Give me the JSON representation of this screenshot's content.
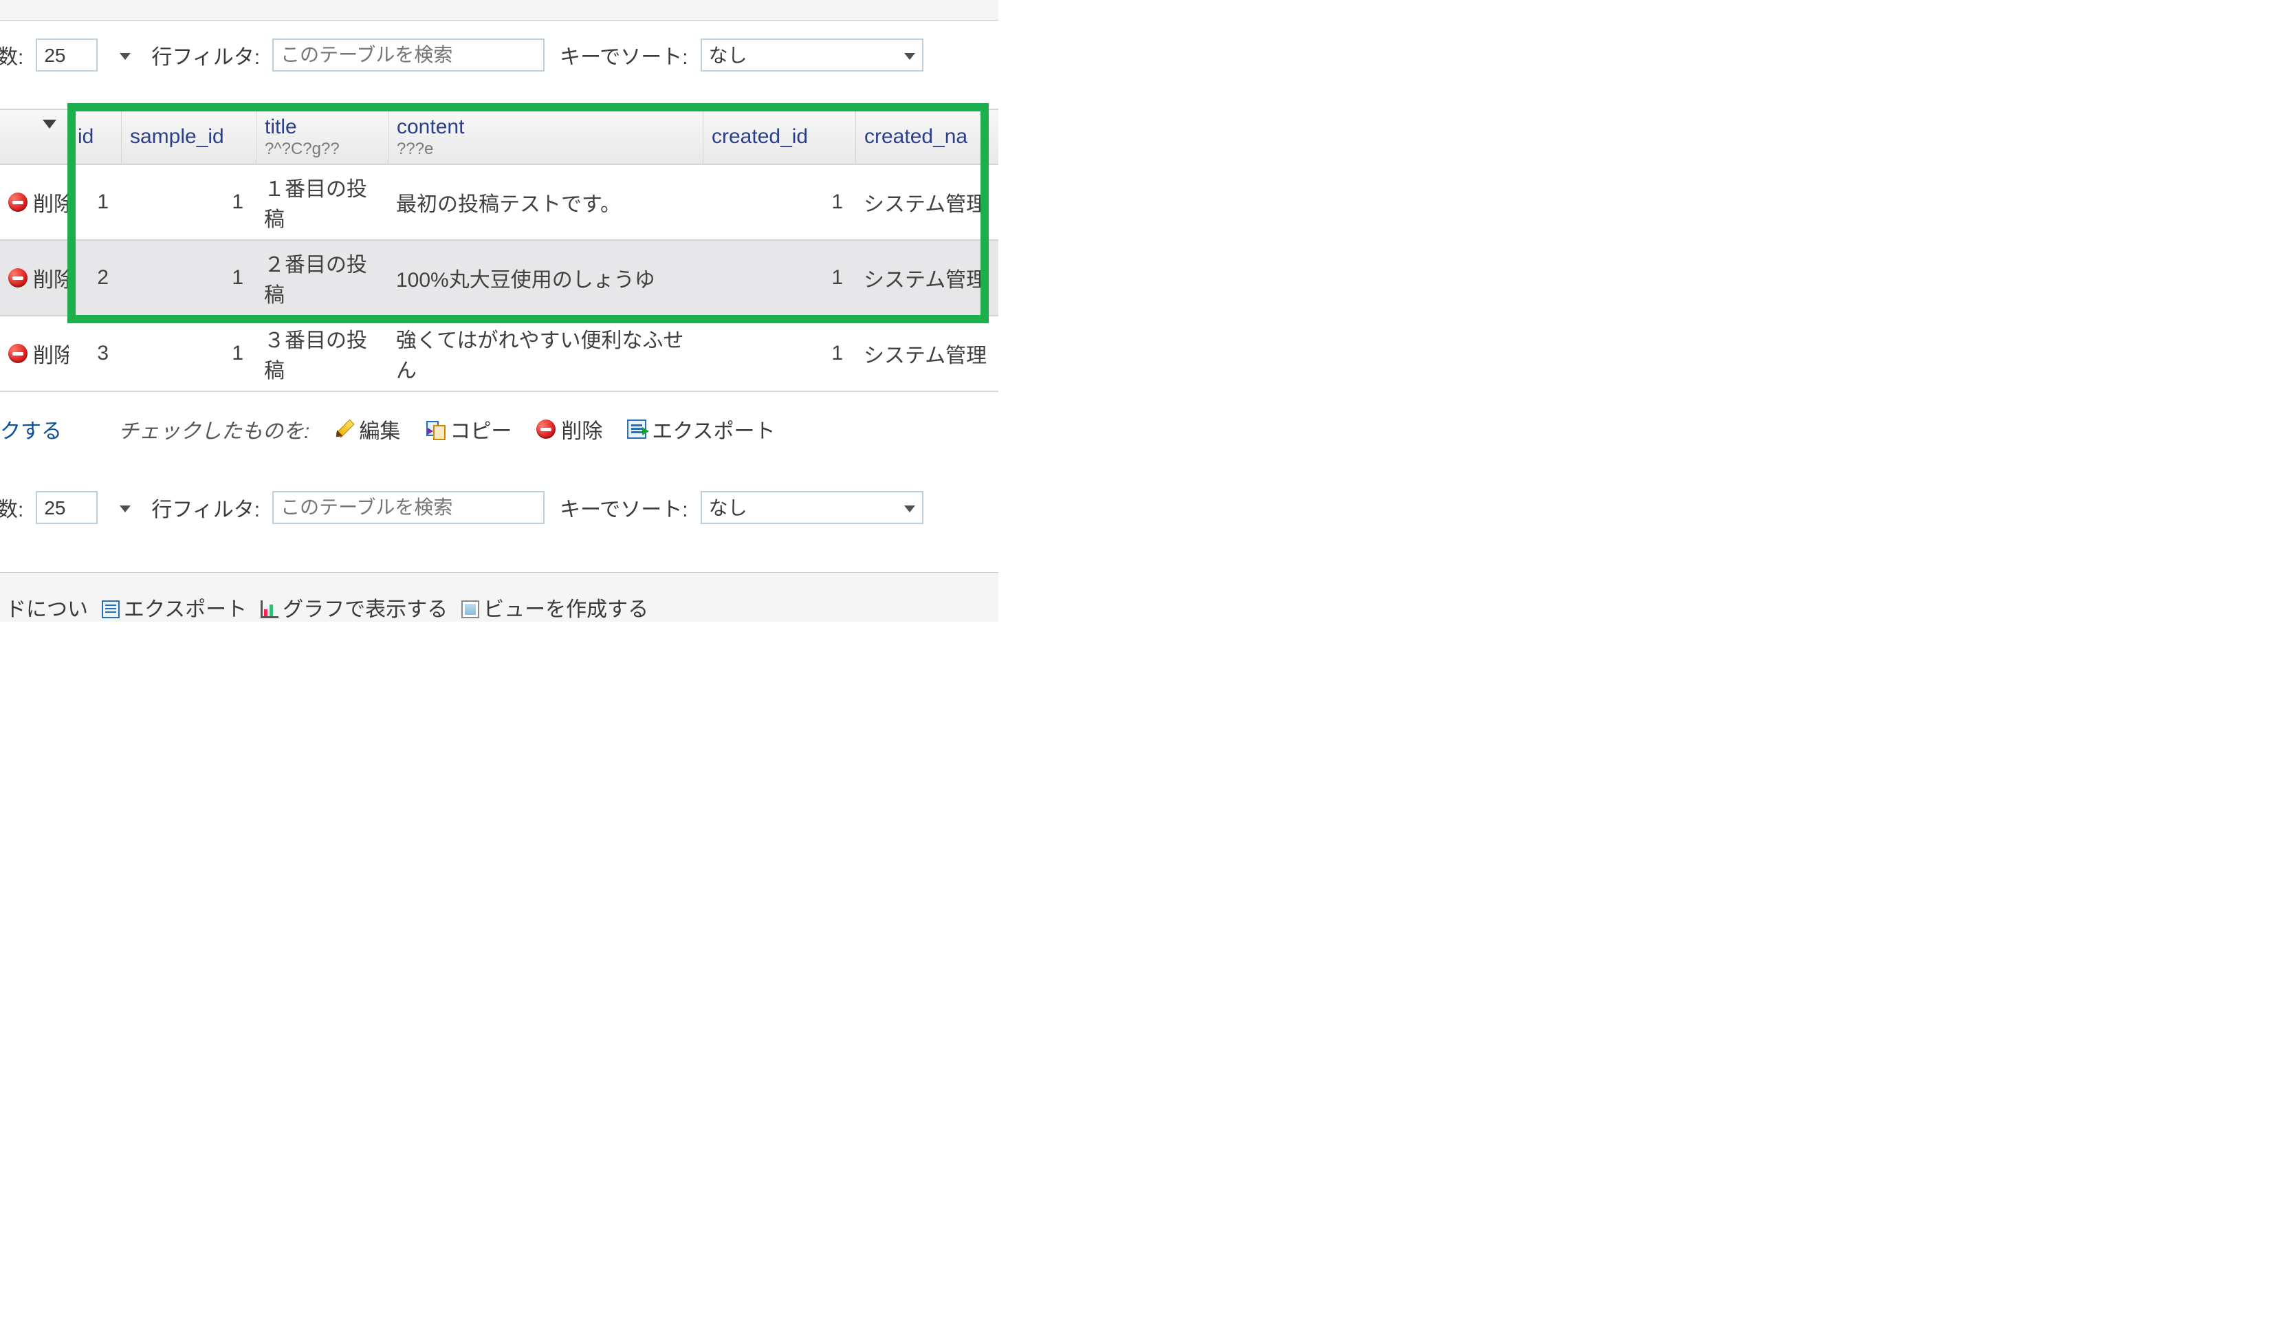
{
  "filter": {
    "rows_label_suffix": "数:",
    "rows_value": "25",
    "filter_label": "行フィルタ:",
    "filter_placeholder": "このテーブルを検索",
    "sort_label": "キーでソート:",
    "sort_value": "なし"
  },
  "table": {
    "columns": [
      {
        "name": "",
        "comment": ""
      },
      {
        "name": "id",
        "comment": ""
      },
      {
        "name": "sample_id",
        "comment": ""
      },
      {
        "name": "title",
        "comment": "?^?C?g??"
      },
      {
        "name": "content",
        "comment": "???e"
      },
      {
        "name": "created_id",
        "comment": ""
      },
      {
        "name": "created_na",
        "comment": ""
      }
    ],
    "row_action_label": "削除",
    "rows": [
      {
        "id": "1",
        "sample_id": "1",
        "title": "１番目の投稿",
        "content": "最初の投稿テストです。",
        "created_id": "1",
        "created_na": "システム管理"
      },
      {
        "id": "2",
        "sample_id": "1",
        "title": "２番目の投稿",
        "content": "100%丸大豆使用のしょうゆ",
        "created_id": "1",
        "created_na": "システム管理"
      },
      {
        "id": "3",
        "sample_id": "1",
        "title": "３番目の投稿",
        "content": "強くてはがれやすい便利なふせん",
        "created_id": "1",
        "created_na": "システム管理"
      }
    ]
  },
  "bulk": {
    "checkall_fragment": "クする",
    "with_selected": "チェックしたものを:",
    "edit": "編集",
    "copy": "コピー",
    "delete": "削除",
    "export": "エクスポート"
  },
  "footer": {
    "frag1": "ドについ",
    "frag2": "エクスポート",
    "frag3": "グラフで表示する",
    "frag4": "ビューを作成する"
  }
}
